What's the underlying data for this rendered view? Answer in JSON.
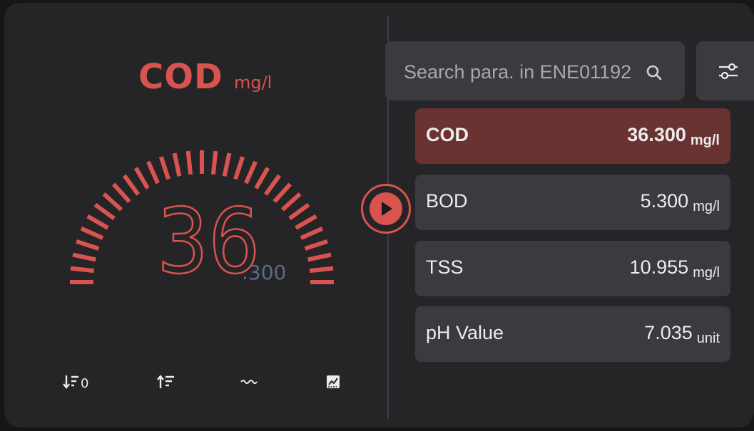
{
  "gauge": {
    "parameter": "COD",
    "unit": "mg/l",
    "integer": "36",
    "fraction": ".300",
    "level_fraction": 1.0,
    "accent_color": "#d9534f"
  },
  "toolbar": [
    {
      "name": "sort-descending-icon",
      "glyph": "↓⁝0"
    },
    {
      "name": "sort-ascending-icon",
      "glyph": "↑⁝"
    },
    {
      "name": "wave-icon",
      "glyph": "〰"
    },
    {
      "name": "chart-icon",
      "glyph": "▨"
    }
  ],
  "search": {
    "placeholder": "Search para. in ENE01192",
    "value": ""
  },
  "parameters": [
    {
      "name": "COD",
      "value": "36.300",
      "unit": "mg/l",
      "active": true
    },
    {
      "name": "BOD",
      "value": "5.300",
      "unit": "mg/l",
      "active": false
    },
    {
      "name": "TSS",
      "value": "10.955",
      "unit": "mg/l",
      "active": false
    },
    {
      "name": "pH Value",
      "value": "7.035",
      "unit": "unit",
      "active": false
    }
  ],
  "colors": {
    "active_row": "#6b3232",
    "row": "#3a3a3f",
    "panel": "#252528",
    "fraction_text": "#5d6a82"
  }
}
